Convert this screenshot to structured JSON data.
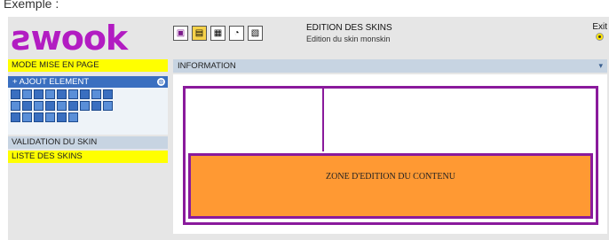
{
  "caption": "Exemple :",
  "header": {
    "logo": "ƨwook",
    "title": "EDITION DES SKINS",
    "subtitle": "Edition du skin monskin",
    "exit_label": "Exit"
  },
  "toolbar": [
    {
      "icon": "layout-icon",
      "glyph": "▣"
    },
    {
      "icon": "folder-icon",
      "glyph": "▤"
    },
    {
      "icon": "document-icon",
      "glyph": "▦"
    },
    {
      "icon": "help-icon",
      "glyph": "◔"
    },
    {
      "icon": "edit-icon",
      "glyph": "▧"
    }
  ],
  "sidebar": {
    "mode_label": "MODE MISE EN PAGE",
    "ajout_label": "+ AJOUT ELEMENT",
    "ajout_close": "⊗",
    "validation_label": "VALIDATION DU SKIN",
    "liste_label": "LISTE DES SKINS"
  },
  "main": {
    "info_label": "INFORMATION",
    "info_arrow": "▾",
    "zone_label": "ZONE D'EDITION DU CONTENU"
  },
  "colors": {
    "brand": "#b21cc2",
    "accent_yellow": "#ffff00",
    "panel_blue": "#c7d4e2",
    "zone_orange": "#ff9933",
    "border_purple": "#8a1a9c"
  }
}
